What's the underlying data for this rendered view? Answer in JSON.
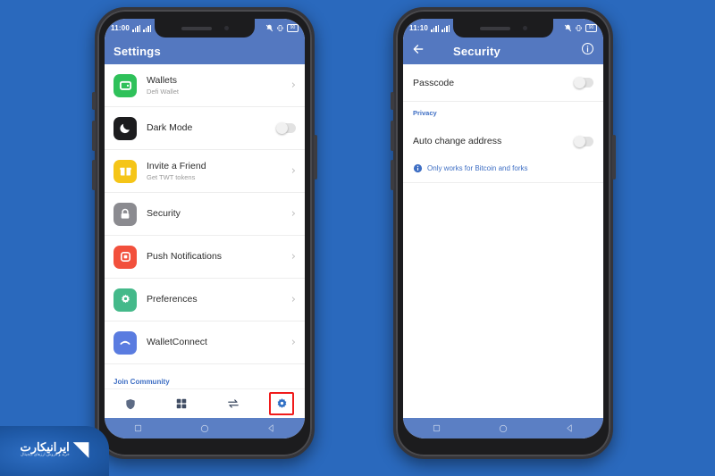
{
  "page": {
    "background_color": "#2a69bd",
    "accent_color": "#5478c0",
    "highlight_color": "#f01b1b",
    "link_color": "#3f6fc4"
  },
  "phone_left": {
    "status_bar": {
      "time": "11:00",
      "mute_icon": "bell-off-icon",
      "vibrate_icon": "vibrate-icon",
      "battery_text": "90"
    },
    "appbar": {
      "title": "Settings"
    },
    "rows": [
      {
        "title": "Wallets",
        "subtitle": "Defi Wallet",
        "icon": "wallet-icon",
        "icon_color": "#2fc15a",
        "accessory": "chevron"
      },
      {
        "title": "Dark Mode",
        "subtitle": "",
        "icon": "moon-icon",
        "icon_color": "#1c1c1e",
        "accessory": "toggle"
      },
      {
        "title": "Invite a Friend",
        "subtitle": "Get TWT tokens",
        "icon": "gift-icon",
        "icon_color": "#f5c518",
        "accessory": "chevron"
      },
      {
        "title": "Security",
        "subtitle": "",
        "icon": "lock-icon",
        "icon_color": "#8b8b90",
        "accessory": "chevron"
      },
      {
        "title": "Push Notifications",
        "subtitle": "",
        "icon": "bell-square-icon",
        "icon_color": "#f2503c",
        "accessory": "chevron"
      },
      {
        "title": "Preferences",
        "subtitle": "",
        "icon": "gear-icon",
        "icon_color": "#44b98a",
        "accessory": "chevron"
      },
      {
        "title": "WalletConnect",
        "subtitle": "",
        "icon": "walletconnect-icon",
        "icon_color": "#5a7ce0",
        "accessory": "chevron"
      }
    ],
    "join_community_label": "Join Community",
    "tabbar": [
      {
        "name": "shield-icon",
        "label": "Shield",
        "selected": false,
        "highlighted": false
      },
      {
        "name": "grid-icon",
        "label": "Apps",
        "selected": false,
        "highlighted": false
      },
      {
        "name": "swap-icon",
        "label": "Swap",
        "selected": false,
        "highlighted": false
      },
      {
        "name": "gear-icon",
        "label": "Settings",
        "selected": true,
        "highlighted": true
      }
    ],
    "android_nav": [
      "square-icon",
      "circle-icon",
      "back-triangle-icon"
    ]
  },
  "phone_right": {
    "status_bar": {
      "time": "11:10",
      "mute_icon": "bell-off-icon",
      "vibrate_icon": "vibrate-icon",
      "battery_text": "90"
    },
    "appbar": {
      "back_icon": "arrow-left-icon",
      "title": "Security",
      "info_icon": "info-circle-icon"
    },
    "rows": [
      {
        "label": "Passcode",
        "accessory": "toggle"
      }
    ],
    "section_label": "Privacy",
    "privacy_rows": [
      {
        "label": "Auto change address",
        "accessory": "toggle"
      }
    ],
    "note": {
      "icon": "info-circle-filled-icon",
      "text": "Only works for Bitcoin and forks"
    },
    "android_nav": [
      "square-icon",
      "circle-icon",
      "back-triangle-icon"
    ]
  },
  "watermark": {
    "brand": "ایرانیکارت",
    "tagline": "خرید و فروش ارزهای دیجیتال",
    "logo": "iranicart-logo-icon"
  }
}
